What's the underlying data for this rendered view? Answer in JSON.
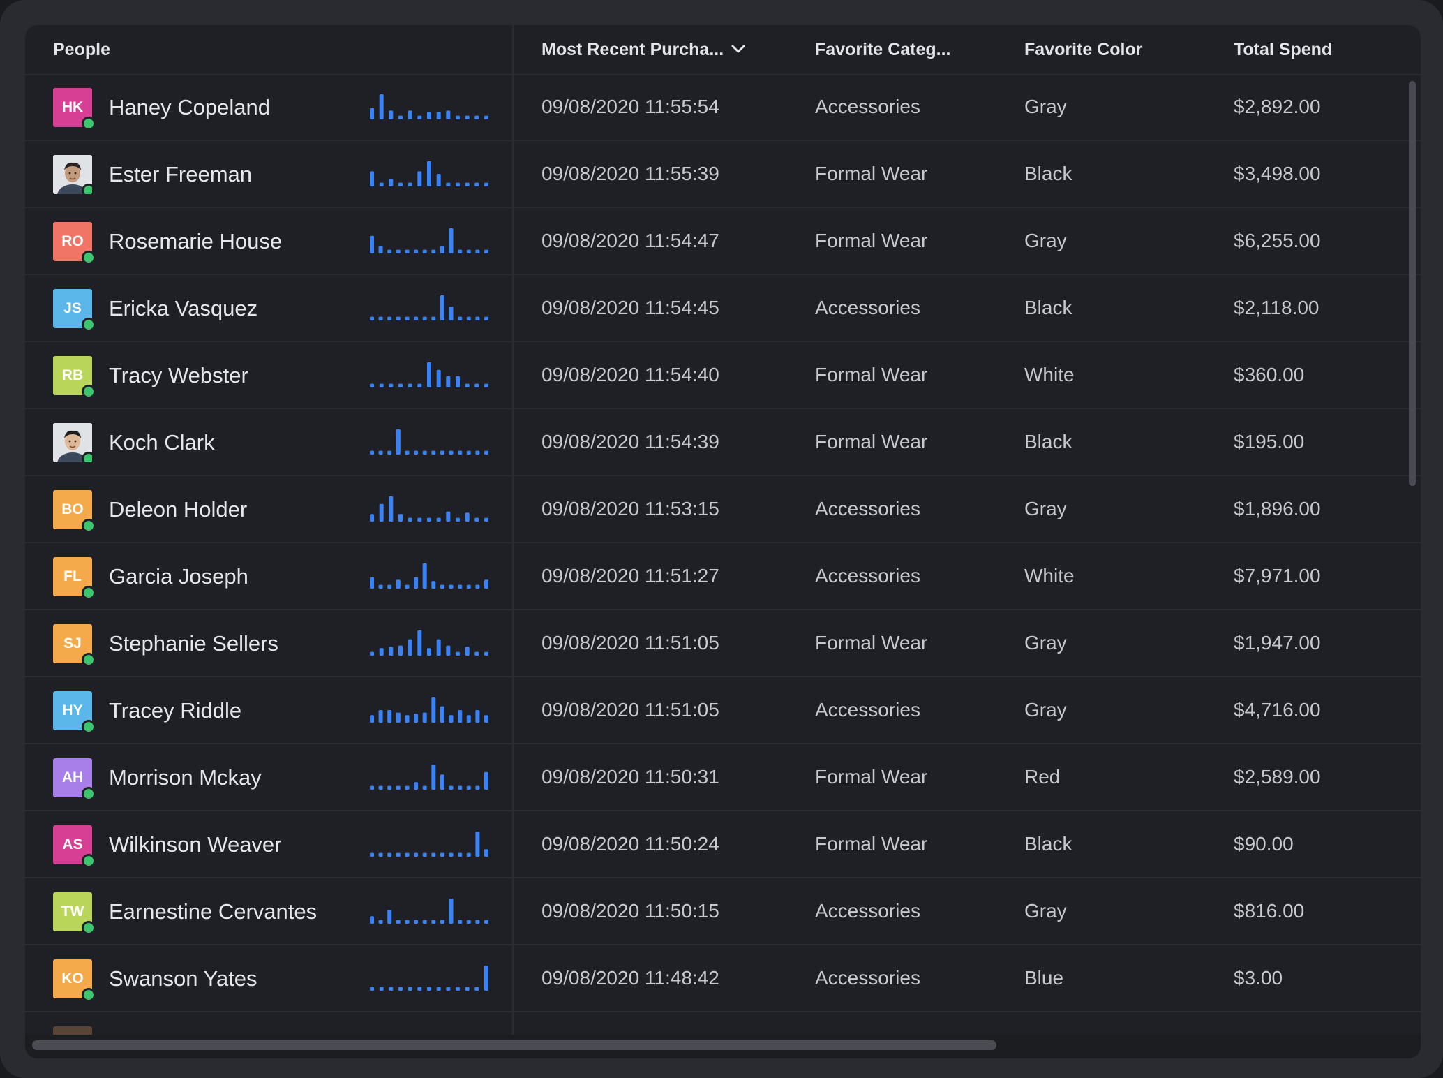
{
  "columns": {
    "people": "People",
    "date": "Most Recent Purcha...",
    "category": "Favorite Categ...",
    "color": "Favorite Color",
    "spend": "Total Spend"
  },
  "sort_icon": "chevron-down-icon",
  "colors": {
    "accent_spark": "#3b82f6",
    "online": "#3cc46e"
  },
  "rows": [
    {
      "initials": "HK",
      "avatar_color": "#d63f93",
      "name": "Haney Copeland",
      "date": "09/08/2020 11:55:54",
      "category": "Accessories",
      "color": "Gray",
      "spend": "$2,892.00",
      "spark": [
        0.45,
        1,
        0.35,
        0.15,
        0.35,
        0.15,
        0.3,
        0.3,
        0.35,
        0.15,
        0.15,
        0.15,
        0.15
      ]
    },
    {
      "initials": "",
      "photo": true,
      "avatar_color": "#c9b19a",
      "name": "Ester Freeman",
      "date": "09/08/2020 11:55:39",
      "category": "Formal Wear",
      "color": "Black",
      "spend": "$3,498.00",
      "spark": [
        0.6,
        0.15,
        0.3,
        0.15,
        0.15,
        0.6,
        1,
        0.5,
        0.15,
        0.15,
        0.15,
        0.15,
        0.15
      ]
    },
    {
      "initials": "RO",
      "avatar_color": "#f07566",
      "name": "Rosemarie House",
      "date": "09/08/2020 11:54:47",
      "category": "Formal Wear",
      "color": "Gray",
      "spend": "$6,255.00",
      "spark": [
        0.7,
        0.3,
        0.15,
        0.15,
        0.15,
        0.15,
        0.15,
        0.15,
        0.3,
        1,
        0.15,
        0.15,
        0.15,
        0.15
      ]
    },
    {
      "initials": "JS",
      "avatar_color": "#5bb7ea",
      "name": "Ericka Vasquez",
      "date": "09/08/2020 11:54:45",
      "category": "Accessories",
      "color": "Black",
      "spend": "$2,118.00",
      "spark": [
        0.15,
        0.15,
        0.15,
        0.15,
        0.15,
        0.15,
        0.15,
        0.15,
        1,
        0.55,
        0.15,
        0.15,
        0.15,
        0.15
      ]
    },
    {
      "initials": "RB",
      "avatar_color": "#b9d65a",
      "name": "Tracy Webster",
      "date": "09/08/2020 11:54:40",
      "category": "Formal Wear",
      "color": "White",
      "spend": "$360.00",
      "spark": [
        0.15,
        0.15,
        0.15,
        0.15,
        0.15,
        0.15,
        1,
        0.7,
        0.45,
        0.45,
        0.15,
        0.15,
        0.15
      ]
    },
    {
      "initials": "",
      "photo": true,
      "avatar_color": "#d8c3ae",
      "name": "Koch Clark",
      "date": "09/08/2020 11:54:39",
      "category": "Formal Wear",
      "color": "Black",
      "spend": "$195.00",
      "spark": [
        0.15,
        0.15,
        0.15,
        1,
        0.15,
        0.15,
        0.15,
        0.15,
        0.15,
        0.15,
        0.15,
        0.15,
        0.15,
        0.15
      ]
    },
    {
      "initials": "BO",
      "avatar_color": "#f4a94a",
      "name": "Deleon Holder",
      "date": "09/08/2020 11:53:15",
      "category": "Accessories",
      "color": "Gray",
      "spend": "$1,896.00",
      "spark": [
        0.3,
        0.7,
        1,
        0.3,
        0.15,
        0.15,
        0.15,
        0.15,
        0.4,
        0.15,
        0.35,
        0.15,
        0.15
      ]
    },
    {
      "initials": "FL",
      "avatar_color": "#f4a94a",
      "name": "Garcia Joseph",
      "date": "09/08/2020 11:51:27",
      "category": "Accessories",
      "color": "White",
      "spend": "$7,971.00",
      "spark": [
        0.45,
        0.15,
        0.15,
        0.35,
        0.15,
        0.45,
        1,
        0.3,
        0.15,
        0.15,
        0.15,
        0.15,
        0.15,
        0.35
      ]
    },
    {
      "initials": "SJ",
      "avatar_color": "#f4a94a",
      "name": "Stephanie Sellers",
      "date": "09/08/2020 11:51:05",
      "category": "Formal Wear",
      "color": "Gray",
      "spend": "$1,947.00",
      "spark": [
        0.15,
        0.3,
        0.35,
        0.4,
        0.65,
        1,
        0.3,
        0.65,
        0.4,
        0.15,
        0.35,
        0.15,
        0.15
      ]
    },
    {
      "initials": "HY",
      "avatar_color": "#5bb7ea",
      "name": "Tracey Riddle",
      "date": "09/08/2020 11:51:05",
      "category": "Accessories",
      "color": "Gray",
      "spend": "$4,716.00",
      "spark": [
        0.3,
        0.5,
        0.5,
        0.4,
        0.3,
        0.35,
        0.4,
        1,
        0.65,
        0.3,
        0.5,
        0.3,
        0.5,
        0.3
      ]
    },
    {
      "initials": "AH",
      "avatar_color": "#a87ee8",
      "name": "Morrison Mckay",
      "date": "09/08/2020 11:50:31",
      "category": "Formal Wear",
      "color": "Red",
      "spend": "$2,589.00",
      "spark": [
        0.15,
        0.15,
        0.15,
        0.15,
        0.15,
        0.3,
        0.15,
        1,
        0.6,
        0.15,
        0.15,
        0.15,
        0.15,
        0.7
      ]
    },
    {
      "initials": "AS",
      "avatar_color": "#d63f93",
      "name": "Wilkinson Weaver",
      "date": "09/08/2020 11:50:24",
      "category": "Formal Wear",
      "color": "Black",
      "spend": "$90.00",
      "spark": [
        0.15,
        0.15,
        0.15,
        0.15,
        0.15,
        0.15,
        0.15,
        0.15,
        0.15,
        0.15,
        0.15,
        0.15,
        1,
        0.3
      ]
    },
    {
      "initials": "TW",
      "avatar_color": "#b9d65a",
      "name": "Earnestine Cervantes",
      "date": "09/08/2020 11:50:15",
      "category": "Accessories",
      "color": "Gray",
      "spend": "$816.00",
      "spark": [
        0.3,
        0.15,
        0.55,
        0.15,
        0.15,
        0.15,
        0.15,
        0.15,
        0.15,
        1,
        0.15,
        0.15,
        0.15,
        0.15
      ]
    },
    {
      "initials": "KO",
      "avatar_color": "#f4a94a",
      "name": "Swanson Yates",
      "date": "09/08/2020 11:48:42",
      "category": "Accessories",
      "color": "Blue",
      "spend": "$3.00",
      "spark": [
        0.15,
        0.15,
        0.15,
        0.15,
        0.15,
        0.15,
        0.15,
        0.15,
        0.15,
        0.15,
        0.15,
        0.15,
        1
      ]
    }
  ]
}
